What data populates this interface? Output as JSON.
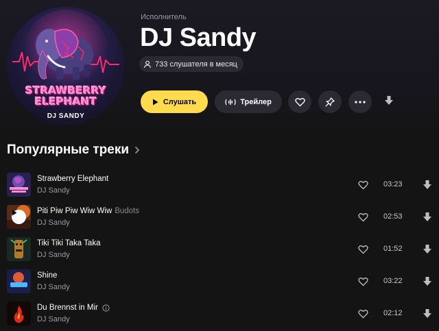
{
  "artist": {
    "kind_label": "Исполнитель",
    "name": "DJ Sandy",
    "listeners": "733 слушателя в месяц",
    "cover": {
      "title_line1": "STRAWBERRY",
      "title_line2": "ELEPHANT",
      "subtitle": "DJ SANDY",
      "icon": "elephant-illustration"
    }
  },
  "actions": {
    "play_label": "Слушать",
    "trailer_label": "Трейлер",
    "icons": [
      "heart-icon",
      "pin-icon",
      "more-icon",
      "download-icon"
    ]
  },
  "popular": {
    "title": "Популярные треки",
    "tracks": [
      {
        "title": "Strawberry Elephant",
        "feat": "",
        "artist": "DJ Sandy",
        "duration": "03:23"
      },
      {
        "title": "Piti Piw Piw Wiw Wiw",
        "feat": "Budots",
        "artist": "DJ Sandy",
        "duration": "02:53"
      },
      {
        "title": "Tiki Tiki Taka Taka",
        "feat": "",
        "artist": "DJ Sandy",
        "duration": "01:52"
      },
      {
        "title": "Shine",
        "feat": "",
        "artist": "DJ Sandy",
        "duration": "03:22"
      },
      {
        "title": "Du Brennst in Mir",
        "feat": "",
        "artist": "DJ Sandy",
        "duration": "02:12"
      }
    ]
  },
  "colors": {
    "background": "#141414",
    "accent": "#ffdb4d",
    "button_bg": "#2b2a33",
    "muted_text": "#9a9aa3"
  }
}
